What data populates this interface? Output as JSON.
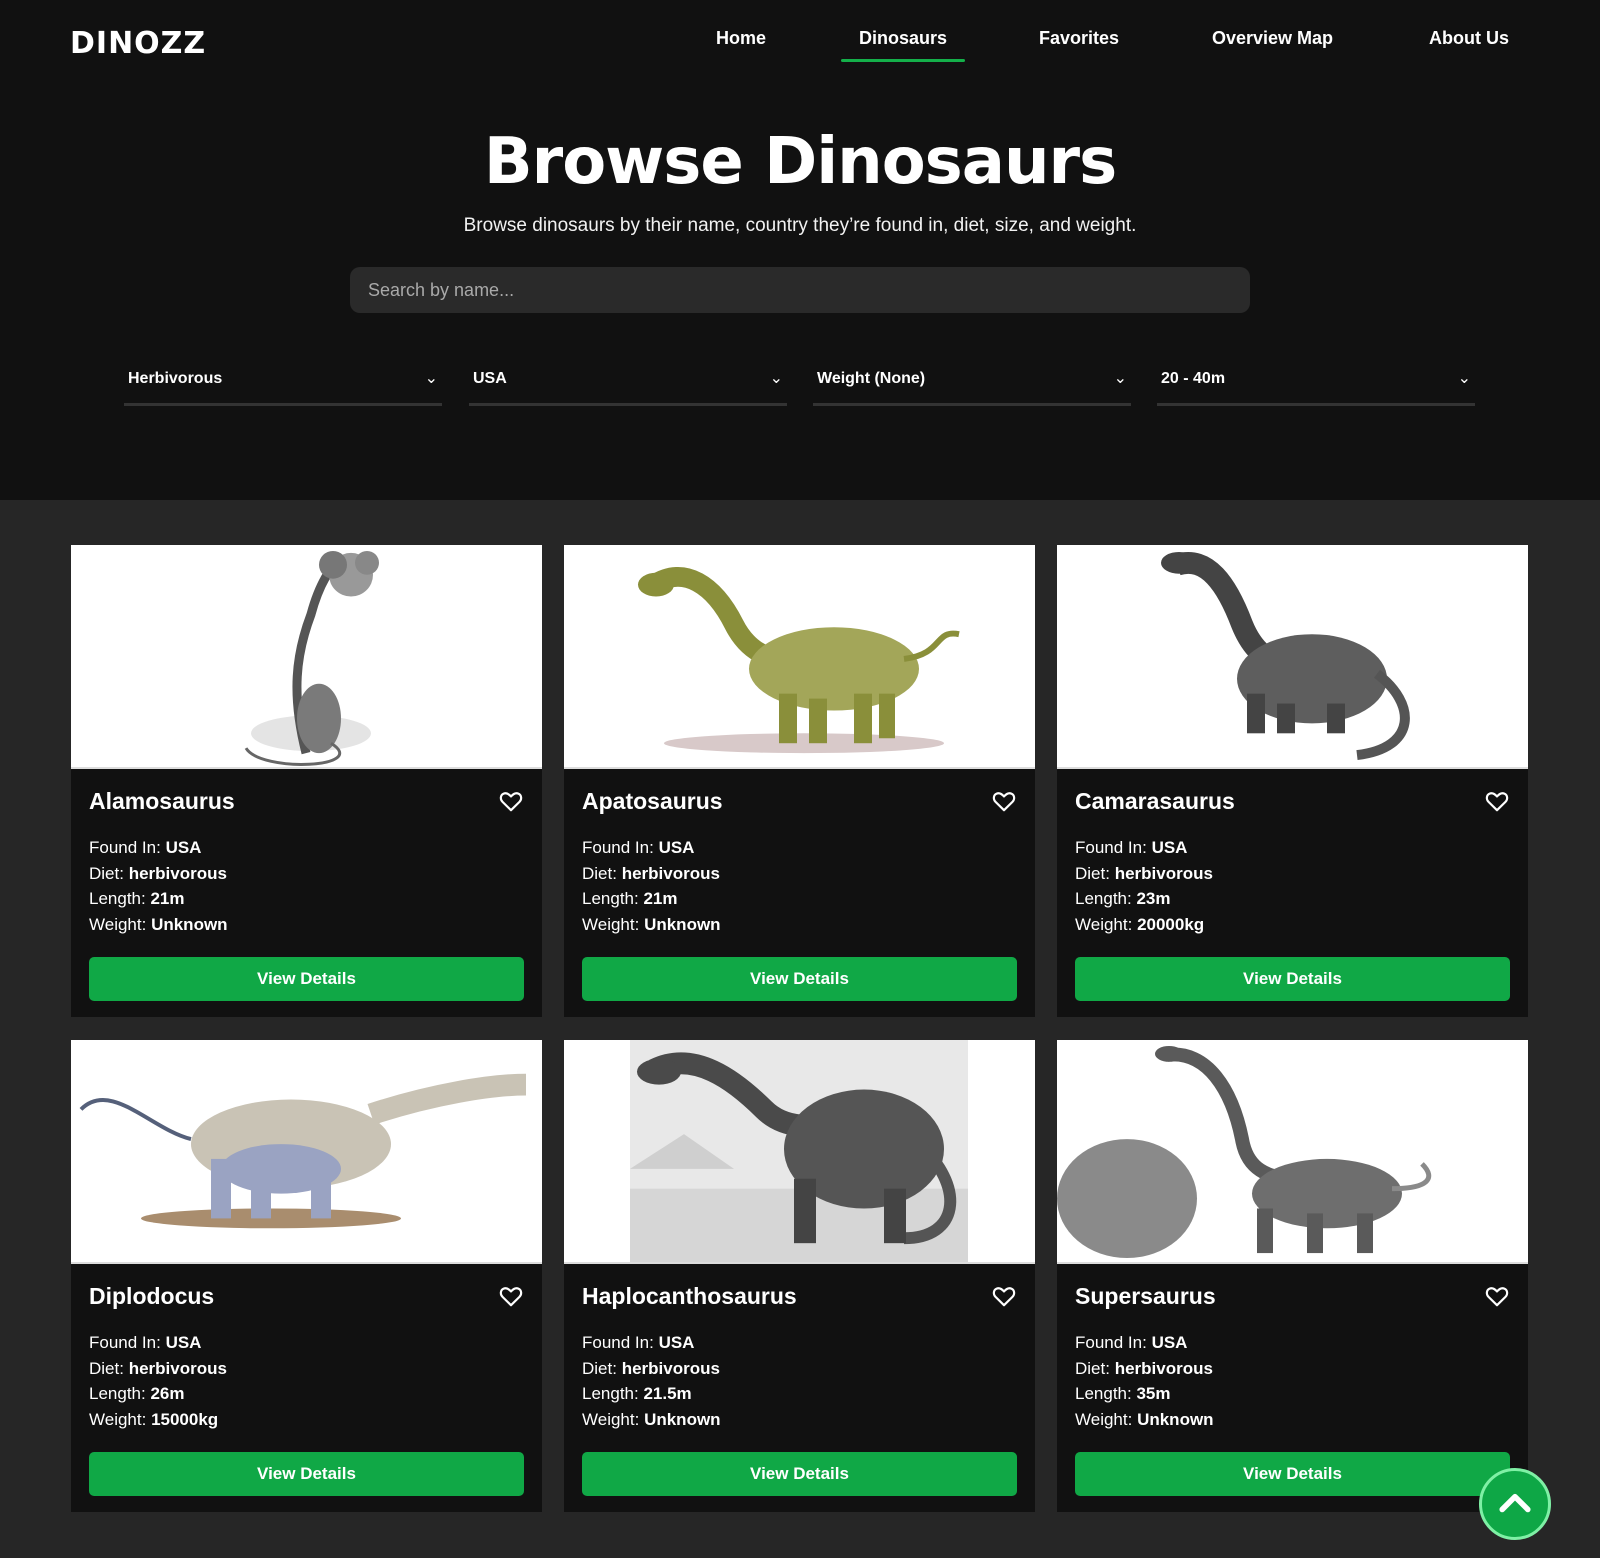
{
  "brand": {
    "logo": "DINOZZ"
  },
  "nav": {
    "items": [
      {
        "label": "Home"
      },
      {
        "label": "Dinosaurs"
      },
      {
        "label": "Favorites"
      },
      {
        "label": "Overview Map"
      },
      {
        "label": "About Us"
      }
    ],
    "active": "Dinosaurs",
    "accent_color": "#14b04a"
  },
  "hero": {
    "title": "Browse Dinosaurs",
    "subtitle": "Browse dinosaurs by their name, country they’re found in, diet, size, and weight."
  },
  "search": {
    "placeholder": "Search by name...",
    "value": ""
  },
  "filters": [
    {
      "label": "Herbivorous"
    },
    {
      "label": "USA"
    },
    {
      "label": "Weight (None)"
    },
    {
      "label": "20 - 40m"
    }
  ],
  "labels": {
    "found_in": "Found In: ",
    "diet": "Diet: ",
    "length": "Length: ",
    "weight": "Weight: ",
    "view_details": "View Details"
  },
  "cards": [
    {
      "name": "Alamosaurus",
      "found_in": "USA",
      "diet": "herbivorous",
      "length": "21m",
      "weight": "Unknown",
      "image_style": "sketch"
    },
    {
      "name": "Apatosaurus",
      "found_in": "USA",
      "diet": "herbivorous",
      "length": "21m",
      "weight": "Unknown",
      "image_style": "color-olive"
    },
    {
      "name": "Camarasaurus",
      "found_in": "USA",
      "diet": "herbivorous",
      "length": "23m",
      "weight": "20000kg",
      "image_style": "gray"
    },
    {
      "name": "Diplodocus",
      "found_in": "USA",
      "diet": "herbivorous",
      "length": "26m",
      "weight": "15000kg",
      "image_style": "color-blue"
    },
    {
      "name": "Haplocanthosaurus",
      "found_in": "USA",
      "diet": "herbivorous",
      "length": "21.5m",
      "weight": "Unknown",
      "image_style": "gray-landscape"
    },
    {
      "name": "Supersaurus",
      "found_in": "USA",
      "diet": "herbivorous",
      "length": "35m",
      "weight": "Unknown",
      "image_style": "sketch-striped"
    }
  ],
  "icons": {
    "favorite": "heart-outline-icon",
    "scroll_top": "chevron-up-icon",
    "filter": "chevron-down-icon"
  },
  "colors": {
    "button": "#10a846",
    "background": "#111111",
    "page": "#262626"
  }
}
